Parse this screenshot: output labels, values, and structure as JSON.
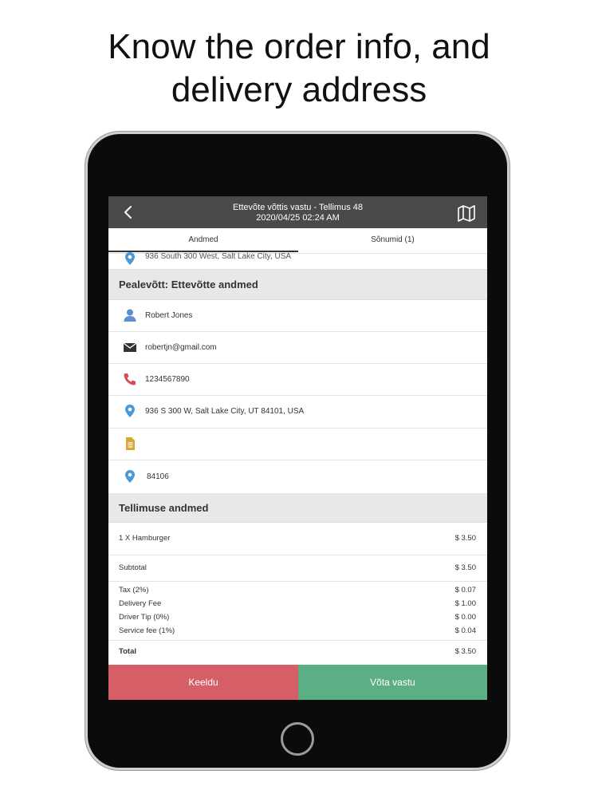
{
  "headline": {
    "line1": "Know the order info, and",
    "line2": "delivery address"
  },
  "topbar": {
    "title": "Ettevõte võttis vastu - Tellimus 48",
    "datetime": "2020/04/25 02:24 AM"
  },
  "tabs": [
    {
      "label": "Andmed",
      "active": true
    },
    {
      "label": "Sõnumid (1)",
      "active": false
    }
  ],
  "partial_address": "936 South 300 West, Salt Lake City, USA",
  "pickup": {
    "heading": "Pealevõtt: Ettevõtte andmed",
    "name": "Robert Jones",
    "email": "robertjn@gmail.com",
    "phone": "1234567890",
    "address": "936 S 300 W, Salt Lake City, UT 84101, USA",
    "note": "",
    "zip": "84106"
  },
  "order": {
    "heading": "Tellimuse andmed",
    "item": {
      "label": "1 X Hamburger",
      "amount": "$ 3.50"
    },
    "subtotal": {
      "label": "Subtotal",
      "amount": "$ 3.50"
    },
    "fees": [
      {
        "label": "Tax (2%)",
        "amount": "$ 0.07"
      },
      {
        "label": "Delivery Fee",
        "amount": "$ 1.00"
      },
      {
        "label": "Driver Tip (0%)",
        "amount": "$ 0.00"
      },
      {
        "label": "Service fee (1%)",
        "amount": "$ 0.04"
      }
    ],
    "total": {
      "label": "Total",
      "amount": "$ 3.50"
    }
  },
  "actions": {
    "reject": "Keeldu",
    "accept": "Võta vastu"
  },
  "colors": {
    "reject": "#d65f67",
    "accept": "#5caf85",
    "topbar": "#4a4a4a",
    "person_icon": "#5b8fd0",
    "pin_icon": "#4a9ad9",
    "phone_icon": "#d64a5a",
    "note_icon": "#d7a637"
  }
}
